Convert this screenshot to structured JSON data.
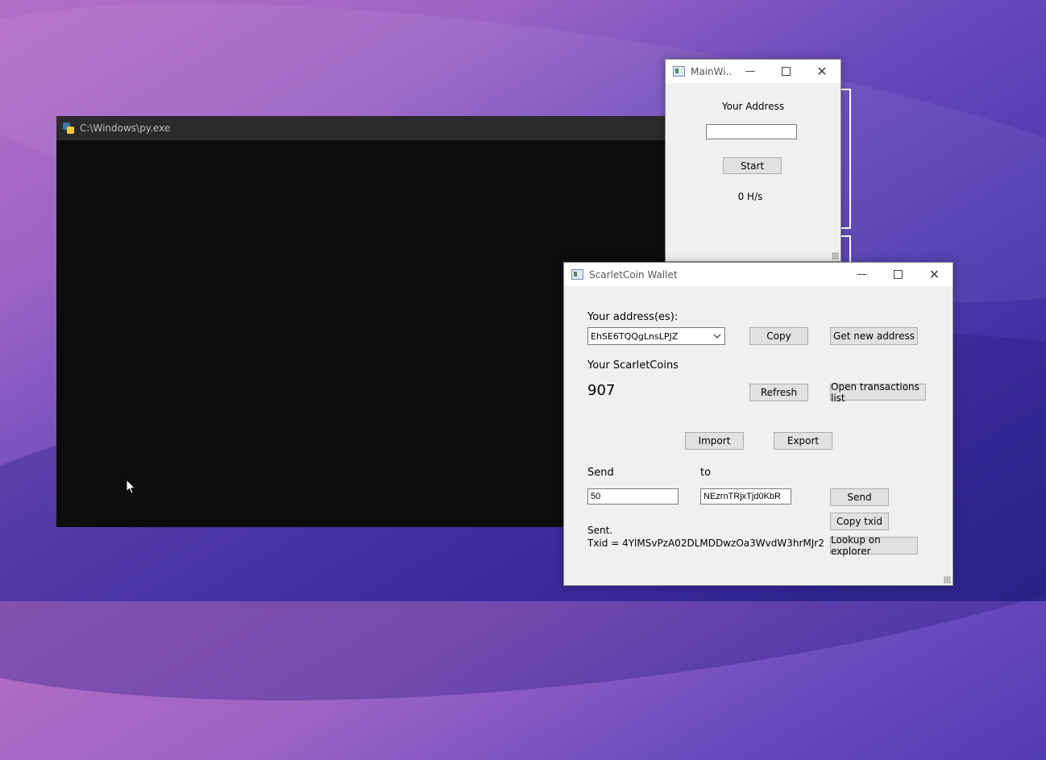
{
  "console": {
    "title": "C:\\Windows\\py.exe"
  },
  "miner": {
    "title": "MainWi...",
    "address_label": "Your Address",
    "address_value": "",
    "start_button": "Start",
    "hashrate": "0 H/s"
  },
  "wallet": {
    "title": "ScarletCoin Wallet",
    "address_label": "Your address(es):",
    "selected_address": "EhSE6TQQgLnsLPJZ",
    "copy_button": "Copy",
    "new_address_button": "Get new address",
    "coins_label": "Your ScarletCoins",
    "balance": "907",
    "refresh_button": "Refresh",
    "transactions_button": "Open transactions list",
    "import_button": "Import",
    "export_button": "Export",
    "send_label": "Send",
    "to_label": "to",
    "amount_value": "50",
    "recipient_value": "NEzrnTRjxTjd0KbR",
    "send_button": "Send",
    "copy_txid_button": "Copy txid",
    "explorer_button": "Lookup on explorer",
    "status_line1": "Sent.",
    "status_line2": "Txid = 4YlMSvPzA02DLMDDwzOa3WvdW3hrMJr2"
  },
  "icons": {
    "minimize": "minimize-icon",
    "maximize": "maximize-icon",
    "close": "close-icon"
  }
}
